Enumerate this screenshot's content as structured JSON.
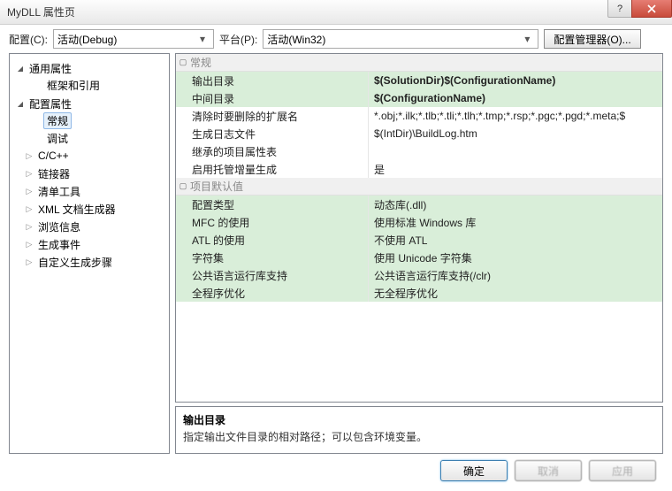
{
  "window": {
    "title": "MyDLL 属性页",
    "help": "?",
    "close": "×"
  },
  "toolbar": {
    "config_label": "配置(C):",
    "config_value": "活动(Debug)",
    "platform_label": "平台(P):",
    "platform_value": "活动(Win32)",
    "manager_button": "配置管理器(O)..."
  },
  "tree": {
    "common": "通用属性",
    "framework": "框架和引用",
    "config_props": "配置属性",
    "general": "常规",
    "debugging": "调试",
    "cpp": "C/C++",
    "linker": "链接器",
    "manifest": "清单工具",
    "xmldoc": "XML 文档生成器",
    "browse": "浏览信息",
    "buildevents": "生成事件",
    "custom": "自定义生成步骤"
  },
  "sections": {
    "general": "常规",
    "defaults": "项目默认值"
  },
  "props": {
    "output_dir_k": "输出目录",
    "output_dir_v": "$(SolutionDir)$(ConfigurationName)",
    "intermediate_dir_k": "中间目录",
    "intermediate_dir_v": "$(ConfigurationName)",
    "clean_ext_k": "清除时要删除的扩展名",
    "clean_ext_v": "*.obj;*.ilk;*.tlb;*.tli;*.tlh;*.tmp;*.rsp;*.pgc;*.pgd;*.meta;$",
    "buildlog_k": "生成日志文件",
    "buildlog_v": "$(IntDir)\\BuildLog.htm",
    "inherited_k": "继承的项目属性表",
    "inherited_v": "",
    "managed_incr_k": "启用托管增量生成",
    "managed_incr_v": "是",
    "config_type_k": "配置类型",
    "config_type_v": "动态库(.dll)",
    "mfc_k": "MFC 的使用",
    "mfc_v": "使用标准 Windows 库",
    "atl_k": "ATL 的使用",
    "atl_v": "不使用 ATL",
    "charset_k": "字符集",
    "charset_v": "使用 Unicode 字符集",
    "clr_k": "公共语言运行库支持",
    "clr_v": "公共语言运行库支持(/clr)",
    "wpo_k": "全程序优化",
    "wpo_v": "无全程序优化"
  },
  "description": {
    "title": "输出目录",
    "text": "指定输出文件目录的相对路径；可以包含环境变量。"
  },
  "buttons": {
    "ok": "确定",
    "cancel": "取消",
    "apply": "应用"
  }
}
